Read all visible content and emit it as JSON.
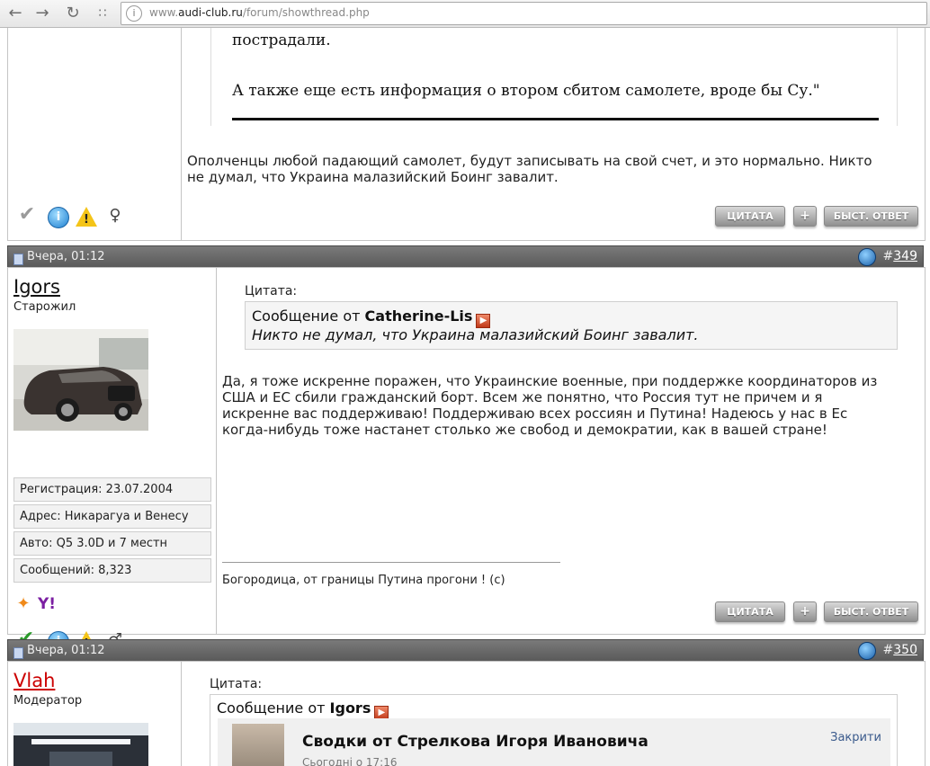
{
  "browser": {
    "url_prefix": "www.",
    "url_domain": "audi-club.ru",
    "url_path": "/forum/showthread.php",
    "back_icon": "arrow-left-icon",
    "forward_icon": "arrow-right-icon",
    "reload_icon": "reload-icon",
    "apps_icon": "apps-grid-icon"
  },
  "post_prev": {
    "image_line1": "пострадали.",
    "image_line2": "А также еще есть информация о втором сбитом самолете, вроде бы Су.\"",
    "text_line1": "Ополченцы любой падающий самолет, будут записывать на свой счет, и это нормально. Никто",
    "text_line2": "не думал, что Украина малазийский Боинг завалит.",
    "quote_button": "ЦИТАТА",
    "plus_button": "+",
    "reply_button": "БЫСТ. ОТВЕТ"
  },
  "post_349": {
    "date": "Вчера, 01:12",
    "number_prefix": "#",
    "number": "349",
    "username": "Igors",
    "user_title": "Старожил",
    "info_registration": "Регистрация: 23.07.2004",
    "info_address": "Адрес: Никарагуа и Венесу",
    "info_auto": "Авто: Q5 3.0D и 7 местн",
    "info_posts": "Сообщений: 8,323",
    "quote_label": "Цитата:",
    "quote_from_prefix": "Сообщение от",
    "quote_author": "Catherine-Lis",
    "quote_text": "Никто не думал, что Украина малазийский Боинг завалит.",
    "text_line1": "Да, я тоже искренне поражен, что Украинские военные, при поддержке координаторов из",
    "text_line2": "США и ЕС сбили гражданский борт. Всем же понятно, что Россия тут не причем и я",
    "text_line3": "искренне вас поддерживаю! Поддерживаю всех россиян и Путина! Надеюсь у нас в Ес",
    "text_line4": "когда-нибудь тоже настанет столько же свобод и демократии, как в вашей стране!",
    "signature": "Богородица, от границы Путина прогони ! (с)",
    "quote_button": "ЦИТАТА",
    "plus_button": "+",
    "reply_button": "БЫСТ. ОТВЕТ"
  },
  "post_350": {
    "date": "Вчера, 01:12",
    "number_prefix": "#",
    "number": "350",
    "username": "Vlah",
    "user_title": "Модератор",
    "quote_label": "Цитата:",
    "quote_from_prefix": "Сообщение от",
    "quote_author": "Igors",
    "embed_title": "Сводки от Стрелкова Игоря Ивановича",
    "embed_subtitle": "Сьогодні о 17:16",
    "embed_close": "Закрити"
  },
  "colors": {
    "header_bg": "#666666",
    "username_moderator": "#cc0000",
    "username_regular": "#111111"
  }
}
